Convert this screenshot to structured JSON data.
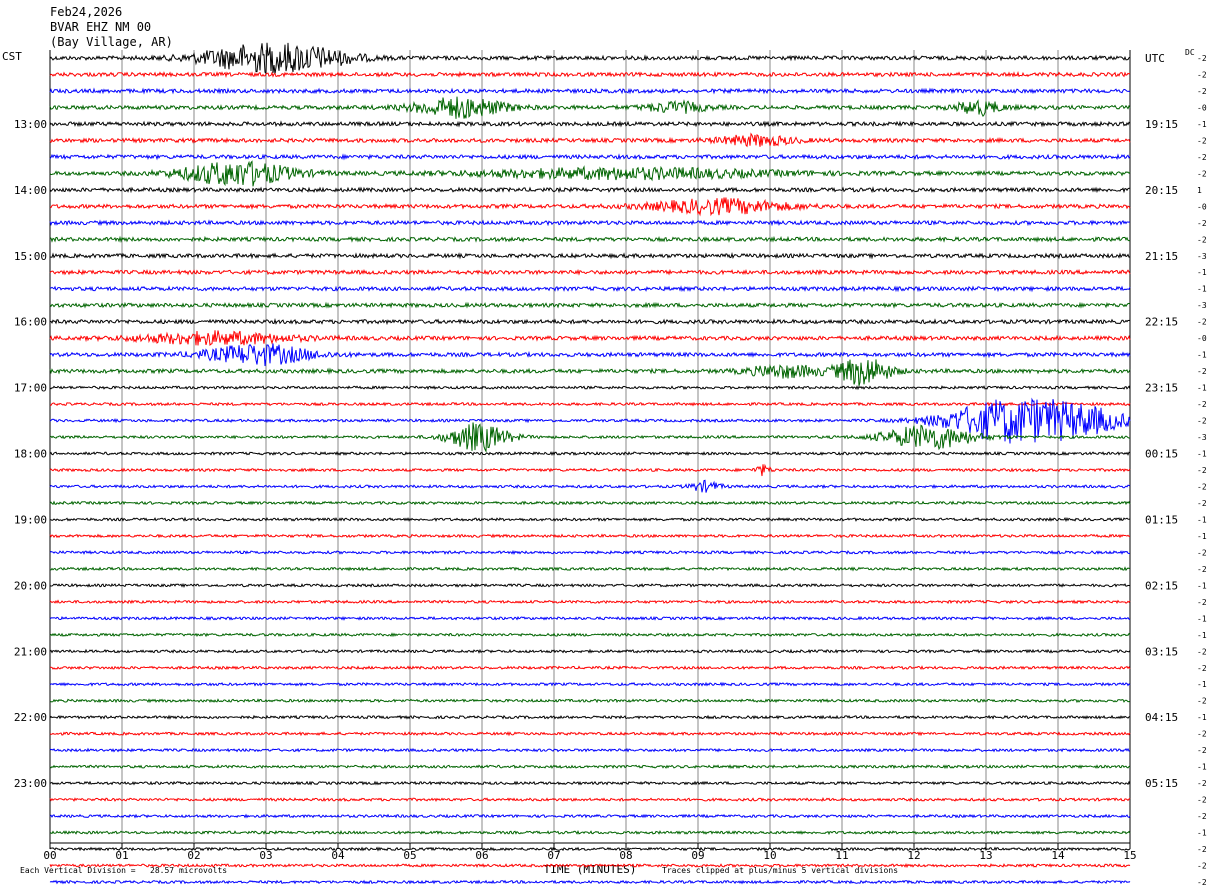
{
  "header": {
    "date": "Feb24,2026",
    "station": "BVAR EHZ NM 00",
    "location": "(Bay Village, AR)"
  },
  "left_tz": "CST",
  "right_tz": "UTC",
  "dc_label": "DC",
  "footer": {
    "scale_note": "Each Vertical Division =   28.57 microvolts",
    "clip_note": "Traces clipped at plus/minus 5 vertical divisions"
  },
  "colors": {
    "trace_cycle": [
      "#000000",
      "#ff0000",
      "#0000ff",
      "#006400"
    ],
    "grid": "#888888"
  },
  "chart_data": {
    "type": "line",
    "title": "BVAR EHZ NM 00 (Bay Village, AR) Feb24,2026",
    "xlabel": "TIME (MINUTES)",
    "xlim": [
      0,
      15
    ],
    "x_ticks": [
      "00",
      "01",
      "02",
      "03",
      "04",
      "05",
      "06",
      "07",
      "08",
      "09",
      "10",
      "11",
      "12",
      "13",
      "14",
      "15"
    ],
    "rows_per_hour": 4,
    "row_minutes": 15,
    "left_hour_labels": [
      "13:00",
      "14:00",
      "15:00",
      "16:00",
      "17:00",
      "18:00",
      "19:00",
      "20:00",
      "21:00",
      "22:00",
      "23:00"
    ],
    "left_first_label_row": 4,
    "right_labels": [
      "UTC",
      "19:15",
      "20:15",
      "21:15",
      "22:15",
      "23:15",
      "00:15",
      "01:15",
      "02:15",
      "03:15",
      "04:15",
      "05:15"
    ],
    "dc_offsets": [
      -2,
      -2,
      -2,
      0,
      -1,
      -2,
      -2,
      -2,
      1,
      0,
      -2,
      -2,
      -3,
      -1,
      -1,
      -3,
      -2,
      0,
      -1,
      -2,
      -1,
      -2,
      -2,
      -3,
      -1,
      -2,
      -2,
      -2,
      -1,
      -1,
      -2,
      -2,
      -1,
      -2,
      -1,
      -1,
      -2,
      -2,
      -1,
      -2,
      -1,
      -2,
      -2,
      -1,
      -2,
      -2,
      -2,
      -1,
      -2,
      -2,
      -2,
      -2
    ],
    "events": [
      {
        "row": 0,
        "minute": 2.9,
        "amp": 13,
        "dur": 1.6
      },
      {
        "row": 0,
        "minute": 3.7,
        "amp": 6,
        "dur": 1.2
      },
      {
        "row": 3,
        "minute": 5.7,
        "amp": 10,
        "dur": 1.2
      },
      {
        "row": 3,
        "minute": 12.9,
        "amp": 7,
        "dur": 0.6
      },
      {
        "row": 3,
        "minute": 8.7,
        "amp": 5,
        "dur": 0.8
      },
      {
        "row": 5,
        "minute": 9.8,
        "amp": 5,
        "dur": 1.0
      },
      {
        "row": 7,
        "minute": 2.6,
        "amp": 12,
        "dur": 1.5
      },
      {
        "row": 7,
        "minute": 8.0,
        "amp": 5,
        "dur": 4.0
      },
      {
        "row": 9,
        "minute": 9.3,
        "amp": 7,
        "dur": 1.8
      },
      {
        "row": 17,
        "minute": 2.3,
        "amp": 6,
        "dur": 2.0
      },
      {
        "row": 18,
        "minute": 2.9,
        "amp": 10,
        "dur": 1.4
      },
      {
        "row": 19,
        "minute": 11.3,
        "amp": 14,
        "dur": 0.7
      },
      {
        "row": 19,
        "minute": 10.2,
        "amp": 6,
        "dur": 1.0
      },
      {
        "row": 22,
        "minute": 13.4,
        "amp": 22,
        "dur": 1.8
      },
      {
        "row": 22,
        "minute": 14.4,
        "amp": 9,
        "dur": 1.2
      },
      {
        "row": 23,
        "minute": 5.95,
        "amp": 14,
        "dur": 0.8
      },
      {
        "row": 23,
        "minute": 12.2,
        "amp": 12,
        "dur": 1.2
      },
      {
        "row": 25,
        "minute": 9.9,
        "amp": 5,
        "dur": 0.2
      },
      {
        "row": 26,
        "minute": 9.1,
        "amp": 5,
        "dur": 0.4
      }
    ],
    "grid": true
  }
}
